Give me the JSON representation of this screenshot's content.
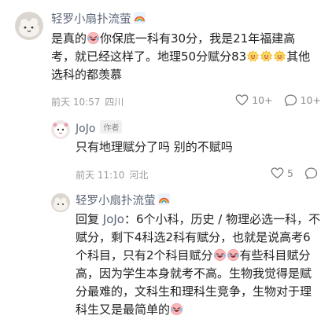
{
  "comments": [
    {
      "username": "轻罗小扇扑流萤",
      "text_parts": [
        "是真的",
        "你保底一科有30分，我是21年福建高考，就已经这样了。地理50分赋分83",
        "其他选科的都羡慕"
      ],
      "time": "前天 10:57",
      "location": "四川",
      "likes": "10+",
      "replies": "10+"
    },
    {
      "username": "JoJo",
      "author_tag": "作者",
      "text": "只有地理赋分了吗 别的不赋吗",
      "time": "前天 11:10",
      "location": "河北",
      "likes": "5"
    },
    {
      "username": "轻罗小扇扑流萤",
      "reply_prefix": "回复 ",
      "reply_to": "JoJo",
      "text_parts": [
        "：6个小科，历史 / 物理必选一科，不赋分，剩下4科选2科有赋分，也就是说高考6个科目，只有2个科目赋分",
        "有些科目赋分高，因为学生本身就考不高。生物我觉得是赋分最难的，文科生和理科生竞争，生物对于理科生又是最简单的"
      ]
    }
  ],
  "icons": {
    "laugh_cry": "laugh-cry-emoji",
    "sun_face": "sun-face-emoji",
    "rainbow": "rainbow-icon",
    "heart": "heart-icon",
    "reply": "comment-bubble-icon"
  }
}
